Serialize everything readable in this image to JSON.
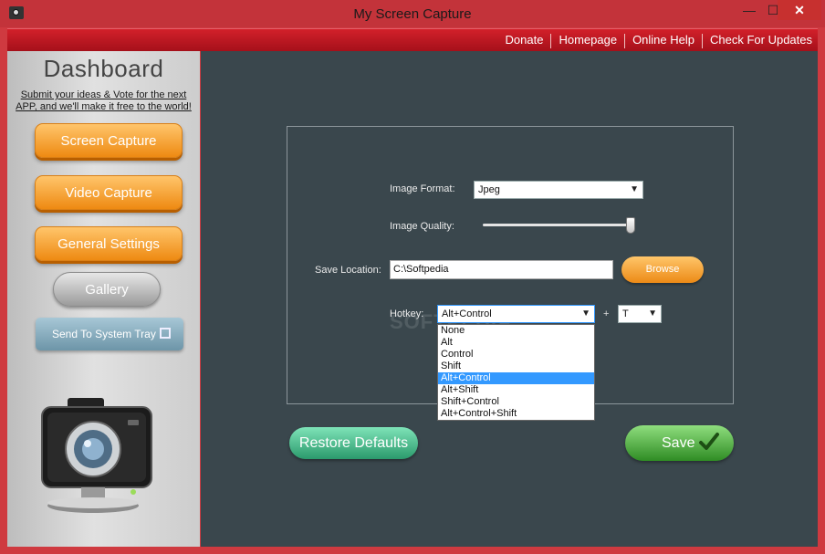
{
  "window": {
    "title": "My Screen Capture"
  },
  "titlebar_buttons": {
    "minimize": "—",
    "maximize": "☐",
    "close": "✕"
  },
  "top_links": [
    "Donate",
    "Homepage",
    "Online Help",
    "Check For Updates"
  ],
  "sidebar": {
    "heading": "Dashboard",
    "promo_line1": "Submit your ideas & Vote for the next",
    "promo_line2": "APP, and we'll make it free to the world!",
    "nav": [
      "Screen Capture",
      "Video Capture",
      "General Settings"
    ],
    "gallery": "Gallery",
    "tray": "Send To System Tray"
  },
  "settings": {
    "image_format_label": "Image Format:",
    "image_format_value": "Jpeg",
    "image_quality_label": "Image Quality:",
    "image_quality_level": 0.98,
    "save_location_label": "Save Location:",
    "save_location_value": "C:\\Softpedia",
    "browse": "Browse",
    "hotkey_label": "Hotkey:",
    "hotkey_modifier": "Alt+Control",
    "hotkey_plus": "+",
    "hotkey_key": "T",
    "hotkey_options": [
      "None",
      "Alt",
      "Control",
      "Shift",
      "Alt+Control",
      "Alt+Shift",
      "Shift+Control",
      "Alt+Control+Shift"
    ],
    "hotkey_selected_index": 4
  },
  "watermark": "SOFTPEDIA",
  "actions": {
    "restore": "Restore Defaults",
    "save": "Save"
  },
  "colors": {
    "accent_orange": "#ee8a12",
    "header_red": "#c3333a",
    "panel_dark": "#3a474d",
    "save_green": "#2f8c24",
    "restore_green": "#2b9a6c"
  }
}
